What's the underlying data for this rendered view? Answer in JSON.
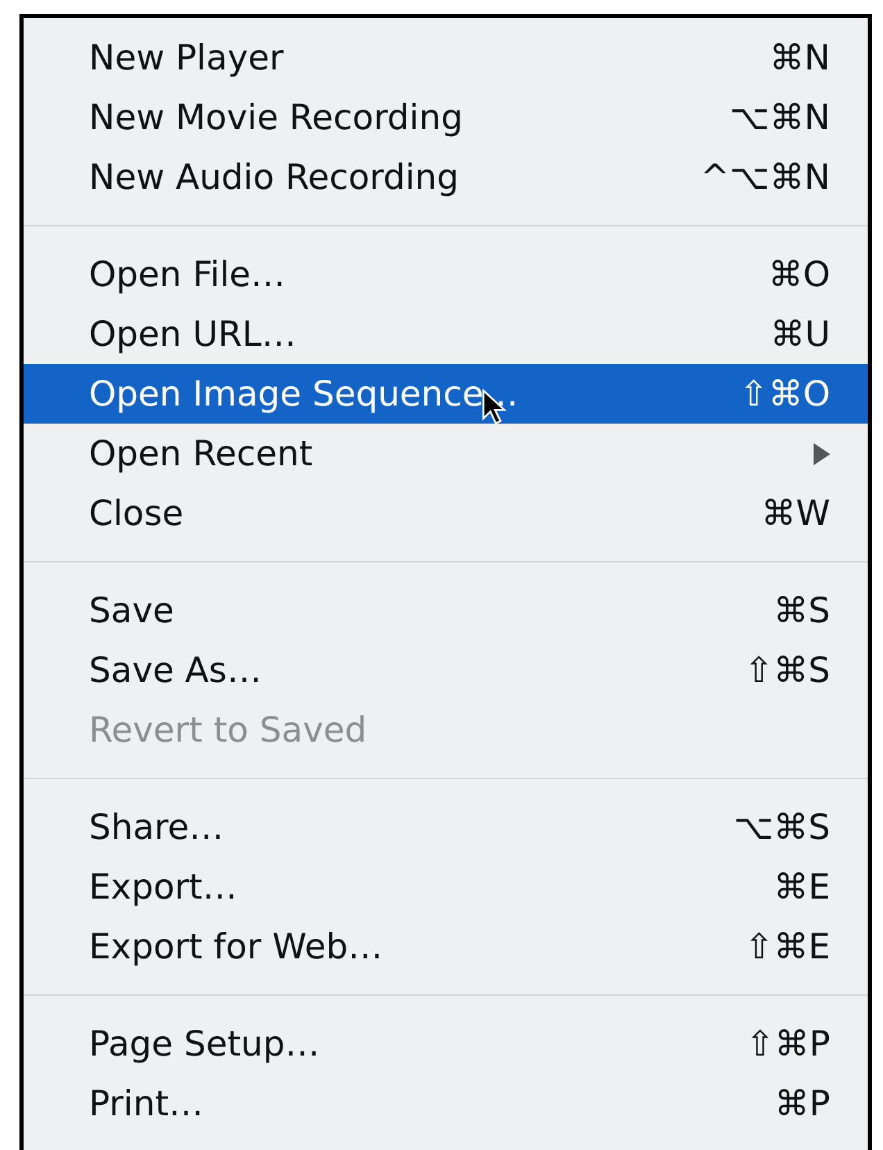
{
  "menu": {
    "groups": [
      {
        "items": [
          {
            "label": "New Player",
            "shortcut": "⌘N",
            "selected": false,
            "disabled": false,
            "submenu": false
          },
          {
            "label": "New Movie Recording",
            "shortcut": "⌥⌘N",
            "selected": false,
            "disabled": false,
            "submenu": false
          },
          {
            "label": "New Audio Recording",
            "shortcut": "^⌥⌘N",
            "selected": false,
            "disabled": false,
            "submenu": false
          }
        ]
      },
      {
        "items": [
          {
            "label": "Open File…",
            "shortcut": "⌘O",
            "selected": false,
            "disabled": false,
            "submenu": false
          },
          {
            "label": "Open URL…",
            "shortcut": "⌘U",
            "selected": false,
            "disabled": false,
            "submenu": false
          },
          {
            "label": "Open Image Sequence…",
            "shortcut": "⇧⌘O",
            "selected": true,
            "disabled": false,
            "submenu": false
          },
          {
            "label": "Open Recent",
            "selected": false,
            "disabled": false,
            "submenu": true
          },
          {
            "label": "Close",
            "shortcut": "⌘W",
            "selected": false,
            "disabled": false,
            "submenu": false
          }
        ]
      },
      {
        "items": [
          {
            "label": "Save",
            "shortcut": "⌘S",
            "selected": false,
            "disabled": false,
            "submenu": false
          },
          {
            "label": "Save As…",
            "shortcut": "⇧⌘S",
            "selected": false,
            "disabled": false,
            "submenu": false
          },
          {
            "label": "Revert to Saved",
            "selected": false,
            "disabled": true,
            "submenu": false
          }
        ]
      },
      {
        "items": [
          {
            "label": "Share…",
            "shortcut": "⌥⌘S",
            "selected": false,
            "disabled": false,
            "submenu": false
          },
          {
            "label": "Export…",
            "shortcut": "⌘E",
            "selected": false,
            "disabled": false,
            "submenu": false
          },
          {
            "label": "Export for Web…",
            "shortcut": "⇧⌘E",
            "selected": false,
            "disabled": false,
            "submenu": false
          }
        ]
      },
      {
        "items": [
          {
            "label": "Page Setup…",
            "shortcut": "⇧⌘P",
            "selected": false,
            "disabled": false,
            "submenu": false
          },
          {
            "label": "Print…",
            "shortcut": "⌘P",
            "selected": false,
            "disabled": false,
            "submenu": false
          }
        ]
      }
    ]
  }
}
